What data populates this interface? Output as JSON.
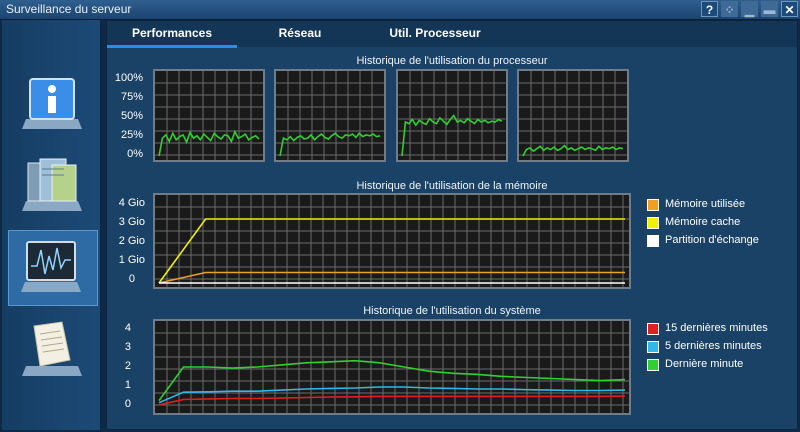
{
  "window": {
    "title": "Surveillance du serveur"
  },
  "titlebar_buttons": [
    {
      "name": "help",
      "glyph": "?"
    },
    {
      "name": "network",
      "glyph": "⁘"
    },
    {
      "name": "minimize",
      "glyph": "▁"
    },
    {
      "name": "maximize",
      "glyph": "▬"
    },
    {
      "name": "close",
      "glyph": "✕"
    }
  ],
  "sidebar": {
    "items": [
      {
        "name": "information",
        "icon": "info-icon"
      },
      {
        "name": "storage",
        "icon": "storage-icon"
      },
      {
        "name": "monitor",
        "icon": "monitor-chart-icon",
        "active": true
      },
      {
        "name": "logs",
        "icon": "document-icon"
      }
    ]
  },
  "tabs": [
    {
      "label": "Performances",
      "active": true
    },
    {
      "label": "Réseau"
    },
    {
      "label": "Util. Processeur"
    }
  ],
  "cpu_section": {
    "title": "Historique de l'utilisation du processeur",
    "ticks": [
      "100%",
      "75%",
      "50%",
      "25%",
      "0%"
    ]
  },
  "memory_section": {
    "title": "Historique de l'utilisation de la mémoire",
    "ticks": [
      "4 Gio",
      "3 Gio",
      "2 Gio",
      "1 Gio",
      "0"
    ],
    "legend": [
      {
        "label": "Mémoire utilisée",
        "color": "#f0a020"
      },
      {
        "label": "Mémoire cache",
        "color": "#f0f000"
      },
      {
        "label": "Partition d'échange",
        "color": "#ffffff"
      }
    ]
  },
  "system_section": {
    "title": "Historique de l'utilisation du système",
    "ticks": [
      "4",
      "3",
      "2",
      "1",
      "0"
    ],
    "legend": [
      {
        "label": "15 dernières minutes",
        "color": "#e02020"
      },
      {
        "label": "5 dernières minutes",
        "color": "#30b8e8"
      },
      {
        "label": "Dernière minute",
        "color": "#30d030"
      }
    ]
  },
  "chart_data": [
    {
      "type": "line",
      "name": "cpu-core-1",
      "ylim": [
        0,
        100
      ],
      "y": [
        0,
        22,
        26,
        18,
        28,
        20,
        24,
        26,
        17,
        29,
        22,
        25,
        20,
        27,
        23,
        19,
        28,
        24,
        21,
        26,
        25,
        18,
        30,
        22,
        24,
        27,
        20,
        23,
        25,
        21
      ]
    },
    {
      "type": "line",
      "name": "cpu-core-2",
      "ylim": [
        0,
        100
      ],
      "y": [
        0,
        22,
        20,
        24,
        19,
        23,
        25,
        21,
        22,
        26,
        20,
        24,
        27,
        23,
        21,
        25,
        28,
        24,
        22,
        26,
        25,
        27,
        23,
        28,
        24,
        26,
        25,
        27,
        24,
        25
      ]
    },
    {
      "type": "line",
      "name": "cpu-core-3",
      "ylim": [
        0,
        100
      ],
      "y": [
        0,
        42,
        40,
        45,
        38,
        44,
        41,
        39,
        46,
        42,
        40,
        47,
        43,
        39,
        45,
        50,
        42,
        44,
        41,
        46,
        43,
        40,
        45,
        42,
        44,
        41,
        43,
        42,
        45,
        43
      ]
    },
    {
      "type": "line",
      "name": "cpu-core-4",
      "ylim": [
        0,
        100
      ],
      "y": [
        0,
        8,
        10,
        6,
        9,
        12,
        7,
        10,
        8,
        11,
        7,
        9,
        13,
        8,
        10,
        7,
        9,
        11,
        8,
        10,
        9,
        7,
        12,
        8,
        10,
        9,
        11,
        8,
        10,
        9
      ]
    },
    {
      "type": "line",
      "name": "memory",
      "ylim": [
        0,
        4
      ],
      "series": [
        {
          "name": "Mémoire utilisée",
          "color": "#f0a020",
          "y": [
            0,
            0.5,
            0.5,
            0.5,
            0.5,
            0.5,
            0.5,
            0.5,
            0.5,
            0.5,
            0.5
          ]
        },
        {
          "name": "Mémoire cache",
          "color": "#f0f000",
          "y": [
            0,
            3.05,
            3.05,
            3.05,
            3.05,
            3.05,
            3.05,
            3.05,
            3.05,
            3.05,
            3.05
          ]
        },
        {
          "name": "Partition d'échange",
          "color": "#ffffff",
          "y": [
            0,
            0,
            0,
            0,
            0,
            0,
            0,
            0,
            0,
            0,
            0
          ]
        }
      ]
    },
    {
      "type": "line",
      "name": "system-load",
      "ylim": [
        0,
        4
      ],
      "series": [
        {
          "name": "15 dernières minutes",
          "color": "#e02020",
          "y": [
            0.2,
            0.45,
            0.48,
            0.5,
            0.5,
            0.52,
            0.55,
            0.57,
            0.58,
            0.6,
            0.6,
            0.6,
            0.6,
            0.6,
            0.6,
            0.6,
            0.6,
            0.6,
            0.6,
            0.62
          ]
        },
        {
          "name": "5 dernières minutes",
          "color": "#30b8e8",
          "y": [
            0.3,
            0.8,
            0.82,
            0.85,
            0.85,
            0.9,
            0.95,
            0.98,
            1.0,
            1.05,
            1.05,
            1.0,
            0.98,
            0.95,
            0.95,
            0.92,
            0.9,
            0.88,
            0.88,
            0.9
          ]
        },
        {
          "name": "Dernière minute",
          "color": "#30d030",
          "y": [
            0.4,
            2.0,
            2.0,
            1.95,
            2.0,
            2.1,
            2.2,
            2.25,
            2.3,
            2.2,
            2.0,
            1.8,
            1.7,
            1.65,
            1.55,
            1.5,
            1.45,
            1.4,
            1.35,
            1.4
          ]
        }
      ]
    }
  ]
}
